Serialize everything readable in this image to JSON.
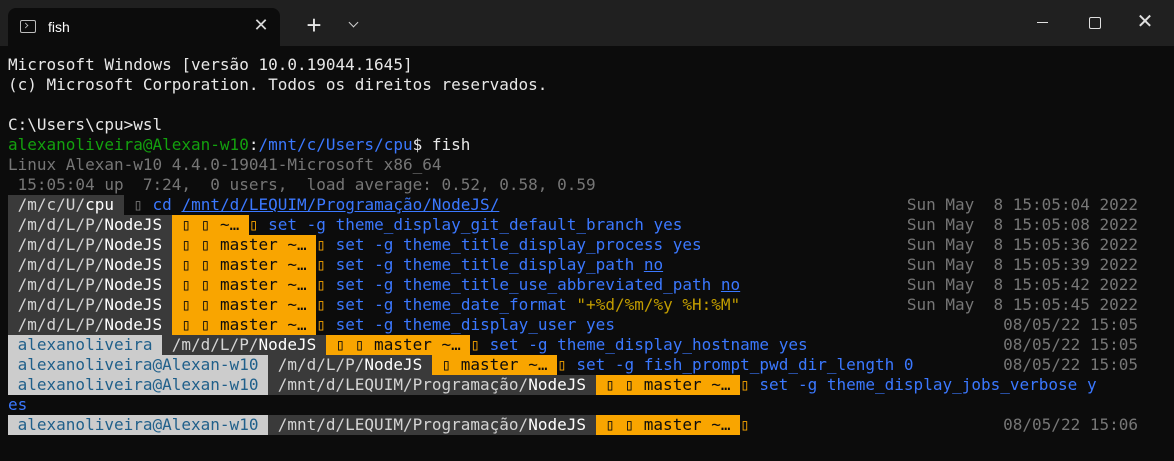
{
  "window": {
    "tab_title": "fish",
    "close_glyph": "✕",
    "new_tab_glyph": "+",
    "close_window_glyph": "✕"
  },
  "terminal": {
    "intro": [
      "Microsoft Windows [versão 10.0.19044.1645]",
      "(c) Microsoft Corporation. Todos os direitos reservados."
    ],
    "cmd_prompt": "C:\\Users\\cpu>",
    "cmd_command": "wsl",
    "bash_user": "alexanoliveira@Alexan-w10",
    "bash_colon": ":",
    "bash_path": "/mnt/c/Users/cpu",
    "bash_dollar": "$ ",
    "bash_command": "fish",
    "uname": "Linux Alexan-w10 4.4.0-19041-Microsoft x86_64",
    "uptime": " 15:05:04 up  7:24,  0 users,  load average: 0.52, 0.58, 0.59",
    "line1": {
      "dir_prefix": "/m/c/U/",
      "dir_base": "cpu",
      "cmd": "cd",
      "arg": "/mnt/d/LEQUIM/Programação/NodeJS/",
      "time": "Sun May  8 15:05:04 2022"
    },
    "line2": {
      "dir_prefix": "/m/d/L/P/",
      "dir_base": "NodeJS",
      "git": " ▯ ▯ ~… ",
      "cmd": "set",
      "flag": "-g",
      "var": "theme_display_git_default_branch",
      "val": "yes",
      "time": "Sun May  8 15:05:08 2022"
    },
    "line3": {
      "dir_prefix": "/m/d/L/P/",
      "dir_base": "NodeJS",
      "git": " ▯ ▯ master ~… ",
      "cmd": "set",
      "flag": "-g",
      "var": "theme_title_display_process",
      "val": "yes",
      "time": "Sun May  8 15:05:36 2022"
    },
    "line4": {
      "dir_prefix": "/m/d/L/P/",
      "dir_base": "NodeJS",
      "git": " ▯ ▯ master ~… ",
      "cmd": "set",
      "flag": "-g",
      "var": "theme_title_display_path",
      "val": "no",
      "time": "Sun May  8 15:05:39 2022"
    },
    "line5": {
      "dir_prefix": "/m/d/L/P/",
      "dir_base": "NodeJS",
      "git": " ▯ ▯ master ~… ",
      "cmd": "set",
      "flag": "-g",
      "var": "theme_title_use_abbreviated_path",
      "val": "no",
      "time": "Sun May  8 15:05:42 2022"
    },
    "line6": {
      "dir_prefix": "/m/d/L/P/",
      "dir_base": "NodeJS",
      "git": " ▯ ▯ master ~… ",
      "cmd": "set",
      "flag": "-g",
      "var": "theme_date_format",
      "val": "\"+%d/%m/%y %H:%M\"",
      "time": "Sun May  8 15:05:45 2022"
    },
    "line7": {
      "dir_prefix": "/m/d/L/P/",
      "dir_base": "NodeJS",
      "git": " ▯ ▯ master ~… ",
      "cmd": "set",
      "flag": "-g",
      "var": "theme_display_user",
      "val": "yes",
      "time": "08/05/22 15:05"
    },
    "line8": {
      "user": " alexanoliveira ",
      "dir_prefix": " /m/d/L/P/",
      "dir_base": "NodeJS",
      "git": " ▯ ▯ master ~… ",
      "cmd": "set",
      "flag": "-g",
      "var": "theme_display_hostname",
      "val": "yes",
      "time": "08/05/22 15:05"
    },
    "line9": {
      "user": " alexanoliveira@Alexan-w10 ",
      "dir_prefix": " /m/d/L/P/",
      "dir_base": "NodeJS",
      "git": " ▯ master ~… ",
      "cmd": "set",
      "flag": "-g",
      "var": "fish_prompt_pwd_dir_length",
      "val": "0",
      "time": "08/05/22 15:05"
    },
    "line10": {
      "user": " alexanoliveira@Alexan-w10 ",
      "dir_prefix": " /mnt/d/LEQUIM/Programação/",
      "dir_base": "NodeJS",
      "git": " ▯ ▯ master ~… ",
      "cmd": "set",
      "flag": "-g",
      "var": "theme_display_jobs_verbose",
      "val": "y",
      "wrap": "es"
    },
    "line11": {
      "user": " alexanoliveira@Alexan-w10 ",
      "dir_prefix": " /mnt/d/LEQUIM/Programação/",
      "dir_base": "NodeJS",
      "git": " ▯ ▯ master ~… ",
      "time": "08/05/22 15:06"
    },
    "glyph": "▯",
    "sep": " ▯ "
  }
}
